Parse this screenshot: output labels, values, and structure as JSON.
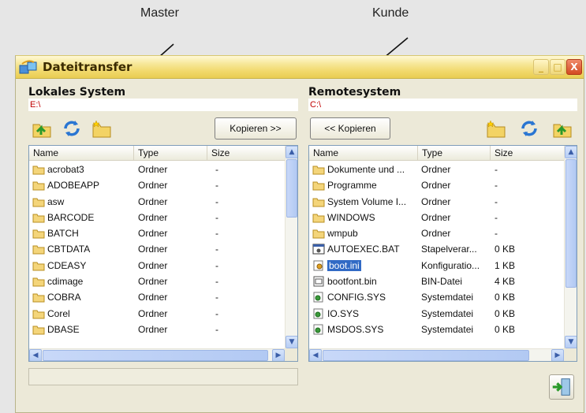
{
  "callouts": {
    "master": "Master",
    "kunde": "Kunde"
  },
  "window": {
    "title": "Dateitransfer",
    "minimize": "_",
    "maximize": "□",
    "close": "X"
  },
  "left": {
    "title": "Lokales System",
    "path": "E:\\",
    "copy_button": "Kopieren >>",
    "headers": {
      "name": "Name",
      "type": "Type",
      "size": "Size"
    },
    "rows": [
      {
        "name": "acrobat3",
        "type": "Ordner",
        "size": "-",
        "icon": "folder-icon"
      },
      {
        "name": "ADOBEAPP",
        "type": "Ordner",
        "size": "-",
        "icon": "folder-icon"
      },
      {
        "name": "asw",
        "type": "Ordner",
        "size": "-",
        "icon": "folder-icon"
      },
      {
        "name": "BARCODE",
        "type": "Ordner",
        "size": "-",
        "icon": "folder-icon"
      },
      {
        "name": "BATCH",
        "type": "Ordner",
        "size": "-",
        "icon": "folder-icon"
      },
      {
        "name": "CBTDATA",
        "type": "Ordner",
        "size": "-",
        "icon": "folder-icon"
      },
      {
        "name": "CDEASY",
        "type": "Ordner",
        "size": "-",
        "icon": "folder-icon"
      },
      {
        "name": "cdimage",
        "type": "Ordner",
        "size": "-",
        "icon": "folder-icon"
      },
      {
        "name": "COBRA",
        "type": "Ordner",
        "size": "-",
        "icon": "folder-icon"
      },
      {
        "name": "Corel",
        "type": "Ordner",
        "size": "-",
        "icon": "folder-icon"
      },
      {
        "name": "DBASE",
        "type": "Ordner",
        "size": "-",
        "icon": "folder-icon"
      }
    ]
  },
  "right": {
    "title": "Remotesystem",
    "path": "C:\\",
    "copy_button": "<< Kopieren",
    "headers": {
      "name": "Name",
      "type": "Type",
      "size": "Size"
    },
    "rows": [
      {
        "name": "Dokumente und ...",
        "type": "Ordner",
        "size": "-",
        "icon": "folder-icon"
      },
      {
        "name": "Programme",
        "type": "Ordner",
        "size": "-",
        "icon": "folder-icon"
      },
      {
        "name": "System Volume I...",
        "type": "Ordner",
        "size": "-",
        "icon": "folder-icon"
      },
      {
        "name": "WINDOWS",
        "type": "Ordner",
        "size": "-",
        "icon": "folder-icon"
      },
      {
        "name": "wmpub",
        "type": "Ordner",
        "size": "-",
        "icon": "folder-icon"
      },
      {
        "name": "AUTOEXEC.BAT",
        "type": "Stapelverar...",
        "size": "0 KB",
        "icon": "batch-file-icon"
      },
      {
        "name": "boot.ini",
        "type": "Konfiguratio...",
        "size": "1 KB",
        "icon": "config-file-icon",
        "selected": true
      },
      {
        "name": "bootfont.bin",
        "type": "BIN-Datei",
        "size": "4 KB",
        "icon": "bin-file-icon"
      },
      {
        "name": "CONFIG.SYS",
        "type": "Systemdatei",
        "size": "0 KB",
        "icon": "system-file-icon"
      },
      {
        "name": "IO.SYS",
        "type": "Systemdatei",
        "size": "0 KB",
        "icon": "system-file-icon"
      },
      {
        "name": "MSDOS.SYS",
        "type": "Systemdatei",
        "size": "0 KB",
        "icon": "system-file-icon"
      }
    ]
  },
  "colors": {
    "path_text": "#c00000",
    "selection": "#316ac5",
    "titlebar": "#f1d86b"
  }
}
